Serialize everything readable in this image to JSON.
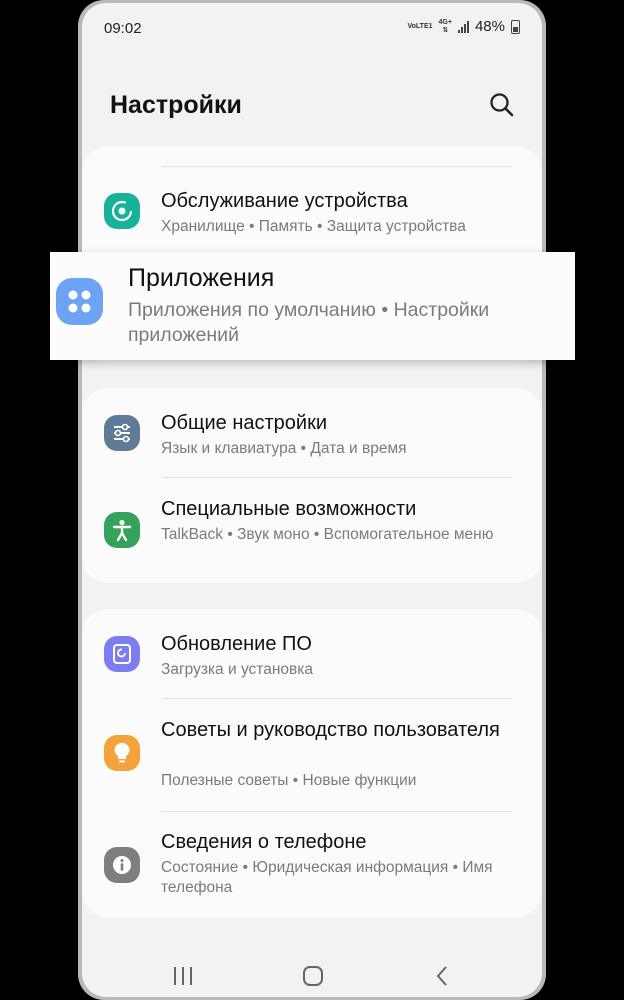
{
  "status_bar": {
    "time": "09:02",
    "network_top": "VoLTE1",
    "network_label": "4G+",
    "battery": "48%"
  },
  "header": {
    "title": "Настройки",
    "search_icon": "search-icon"
  },
  "highlight": {
    "title": "Приложения",
    "subtitle": "Приложения по умолчанию  •  Настройки приложений",
    "icon": "apps-grid-icon",
    "icon_color": "#6da3f3"
  },
  "group1": {
    "items": [
      {
        "title": "Обслуживание устройства",
        "subtitle": "Хранилище  •  Память  •  Защита устройства",
        "icon": "device-care-icon",
        "color": "#18b29b"
      }
    ]
  },
  "group2": {
    "items": [
      {
        "title": "Общие настройки",
        "subtitle": "Язык и клавиатура  •  Дата и время",
        "icon": "sliders-icon",
        "color": "#5f7b98"
      },
      {
        "title": "Специальные возможности",
        "subtitle": "TalkBack  •  Звук моно  •  Вспомогательное меню",
        "icon": "accessibility-icon",
        "color": "#35a25b"
      }
    ]
  },
  "group3": {
    "items": [
      {
        "title": "Обновление ПО",
        "subtitle": "Загрузка и установка",
        "icon": "software-update-icon",
        "color": "#7d7cf0"
      },
      {
        "title": "Советы и руководство пользователя",
        "subtitle": "Полезные советы  •  Новые функции",
        "icon": "lightbulb-icon",
        "color": "#f3a23c"
      },
      {
        "title": "Сведения о телефоне",
        "subtitle": "Состояние  •  Юридическая информация  •  Имя телефона",
        "icon": "info-icon",
        "color": "#7e7e7e"
      }
    ]
  },
  "nav": {
    "recents": "recents-icon",
    "home": "home-icon",
    "back": "back-icon"
  }
}
